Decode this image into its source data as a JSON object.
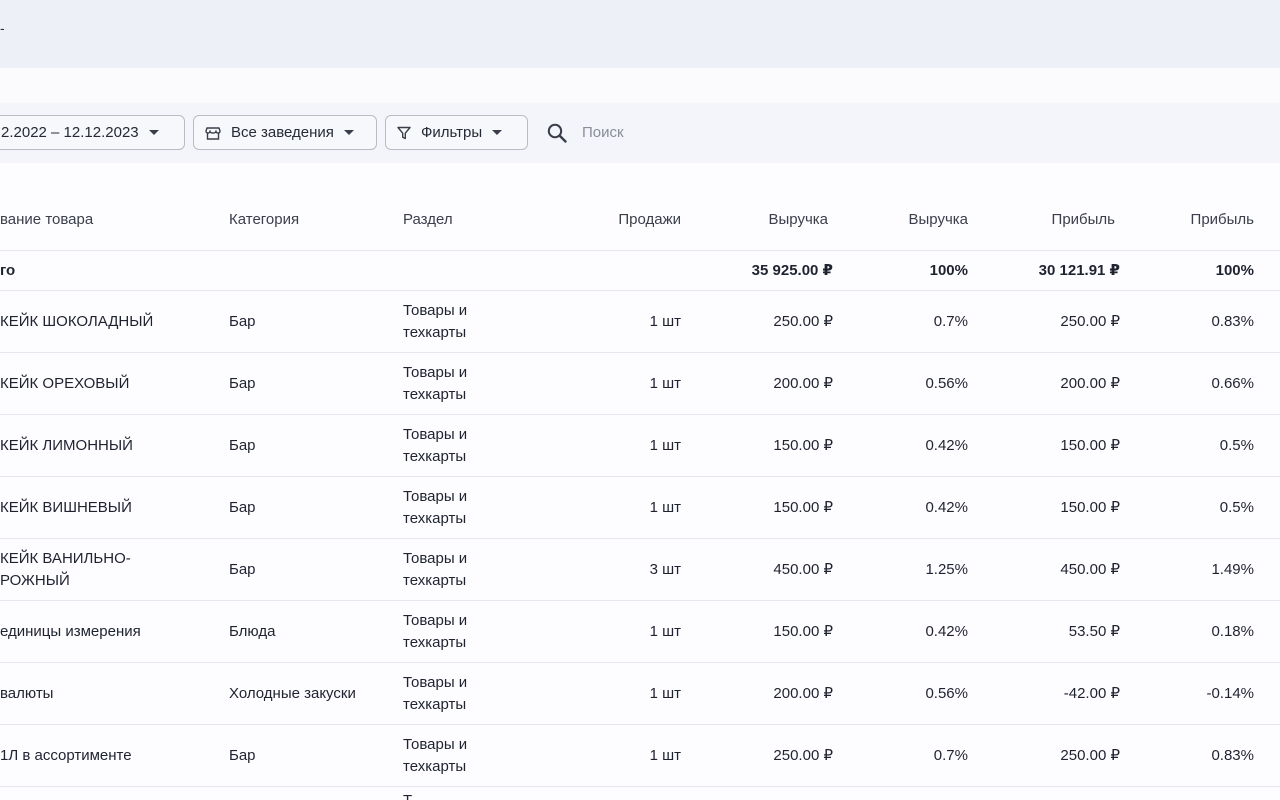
{
  "topbar": {
    "glyph": "-"
  },
  "toolbar": {
    "date_range": "2.2022 – 12.12.2023",
    "venue": "Все заведения",
    "filters": "Фильтры",
    "search_placeholder": "Поиск"
  },
  "table": {
    "headers": {
      "name": "вание товара",
      "category": "Категория",
      "section": "Раздел",
      "sales": "Продажи",
      "revenue": "Выручка",
      "revenue_pct": "Выручка",
      "profit": "Прибыль",
      "profit_pct": "Прибыль"
    },
    "total": {
      "label": "го",
      "revenue": "35 925.00 ₽",
      "revenue_pct": "100%",
      "profit": "30 121.91 ₽",
      "profit_pct": "100%"
    },
    "rows": [
      {
        "name": "КЕЙК ШОКОЛАДНЫЙ",
        "category": "Бар",
        "section": "Товары и техкарты",
        "sales": "1 шт",
        "revenue": "250.00 ₽",
        "revenue_pct": "0.7%",
        "profit": "250.00 ₽",
        "profit_pct": "0.83%"
      },
      {
        "name": "КЕЙК ОРЕХОВЫЙ",
        "category": "Бар",
        "section": "Товары и техкарты",
        "sales": "1 шт",
        "revenue": "200.00 ₽",
        "revenue_pct": "0.56%",
        "profit": "200.00 ₽",
        "profit_pct": "0.66%"
      },
      {
        "name": "КЕЙК ЛИМОННЫЙ",
        "category": "Бар",
        "section": "Товары и техкарты",
        "sales": "1 шт",
        "revenue": "150.00 ₽",
        "revenue_pct": "0.42%",
        "profit": "150.00 ₽",
        "profit_pct": "0.5%"
      },
      {
        "name": "КЕЙК ВИШНЕВЫЙ",
        "category": "Бар",
        "section": "Товары и техкарты",
        "sales": "1 шт",
        "revenue": "150.00 ₽",
        "revenue_pct": "0.42%",
        "profit": "150.00 ₽",
        "profit_pct": "0.5%"
      },
      {
        "name": "КЕЙК ВАНИЛЬНО-РОЖНЫЙ",
        "category": "Бар",
        "section": "Товары и техкарты",
        "sales": "3 шт",
        "revenue": "450.00 ₽",
        "revenue_pct": "1.25%",
        "profit": "450.00 ₽",
        "profit_pct": "1.49%"
      },
      {
        "name": "единицы измерения",
        "category": "Блюда",
        "section": "Товары и техкарты",
        "sales": "1 шт",
        "revenue": "150.00 ₽",
        "revenue_pct": "0.42%",
        "profit": "53.50 ₽",
        "profit_pct": "0.18%"
      },
      {
        "name": "валюты",
        "category": "Холодные закуски",
        "section": "Товары и техкарты",
        "sales": "1 шт",
        "revenue": "200.00 ₽",
        "revenue_pct": "0.56%",
        "profit": "-42.00 ₽",
        "profit_pct": "-0.14%"
      },
      {
        "name": "1Л в ассортименте",
        "category": "Бар",
        "section": "Товары и техкарты",
        "sales": "1 шт",
        "revenue": "250.00 ₽",
        "revenue_pct": "0.7%",
        "profit": "250.00 ₽",
        "profit_pct": "0.83%"
      }
    ],
    "partial_row_section": "Т"
  },
  "colors": {
    "topbar": "#eef0f8",
    "toolbar": "#f4f5fa",
    "border": "#e6e7ee",
    "text": "#1f2330"
  }
}
